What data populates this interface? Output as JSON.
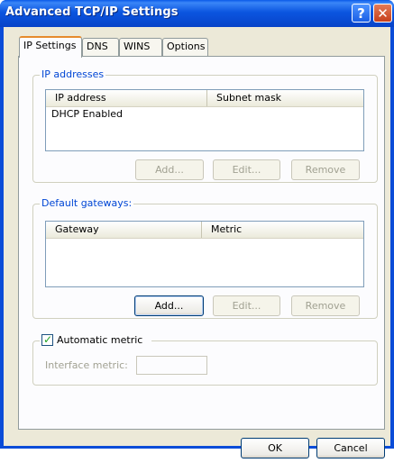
{
  "window": {
    "title": "Advanced TCP/IP Settings"
  },
  "titlebar_buttons": {
    "help": "?",
    "close": "✕"
  },
  "tabs": [
    {
      "label": "IP Settings",
      "active": true
    },
    {
      "label": "DNS",
      "active": false
    },
    {
      "label": "WINS",
      "active": false
    },
    {
      "label": "Options",
      "active": false
    }
  ],
  "ip_addresses": {
    "legend": "IP addresses",
    "columns": [
      "IP address",
      "Subnet mask"
    ],
    "rows": [
      [
        "DHCP Enabled",
        ""
      ]
    ],
    "buttons": {
      "add": "Add...",
      "edit": "Edit...",
      "remove": "Remove"
    }
  },
  "default_gateways": {
    "legend": "Default gateways:",
    "columns": [
      "Gateway",
      "Metric"
    ],
    "rows": [],
    "buttons": {
      "add": "Add...",
      "edit": "Edit...",
      "remove": "Remove"
    }
  },
  "metric": {
    "checkbox_label": "Automatic metric",
    "checked": true,
    "interface_metric_label": "Interface metric:",
    "interface_metric_value": ""
  },
  "footer": {
    "ok": "OK",
    "cancel": "Cancel"
  }
}
